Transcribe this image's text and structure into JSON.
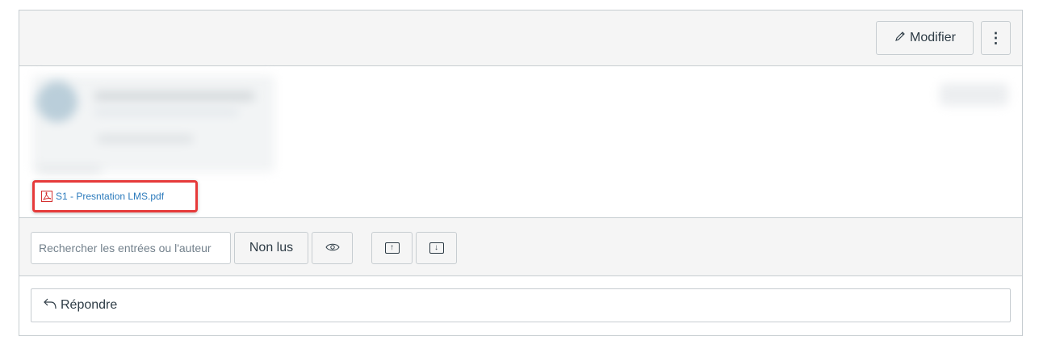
{
  "toolbar": {
    "edit_icon": "pencil-icon",
    "edit_label": "Modifier",
    "more_icon": "kebab-menu-icon",
    "more_label": "⋮"
  },
  "post": {
    "attachment": {
      "icon": "pdf-icon",
      "filename": "S1 - Presntation LMS.pdf"
    }
  },
  "filters": {
    "search_placeholder": "Rechercher les entrées ou l'auteur",
    "unread_label": "Non lus",
    "eye_icon": "eye-icon",
    "expand_icon": "collapse-up-icon",
    "collapse_icon": "expand-down-icon"
  },
  "reply": {
    "icon": "reply-arrow-icon",
    "label": "Répondre"
  },
  "colors": {
    "link": "#2b7abc",
    "highlight": "#e63a3a",
    "toolbar_bg": "#f5f5f5",
    "border": "#c7cdd1"
  }
}
